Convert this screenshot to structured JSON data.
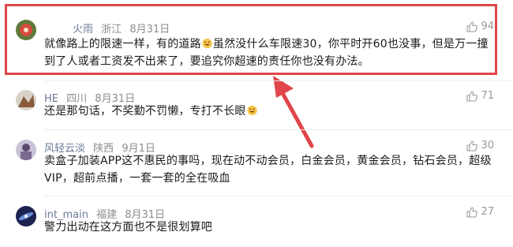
{
  "comments": [
    {
      "nickname": "火雨",
      "region": "浙江",
      "date": "8月31日",
      "likes": "94",
      "text_a": "就像路上的限速一样，有的道路",
      "text_b": "虽然没什么车限速30，你平时开60也没事，但是万一撞到了人或者工资发不出来了，要追究你超速的责任你也没有办法。"
    },
    {
      "nickname": "HE",
      "region": "四川",
      "date": "8月31日",
      "likes": "71",
      "text_a": "还是那句话，不奖勤不罚懒，专打不长眼",
      "text_b": ""
    },
    {
      "nickname": "风轻云淡",
      "region": "陕西",
      "date": "9月1日",
      "likes": "30",
      "text_a": "卖盒子加装APP这不惠民的事吗，现在动不动会员，白金会员，黄金会员，钻石会员，超级VIP，超前点播，一套一套的全在吸血",
      "text_b": ""
    },
    {
      "nickname": "int_main",
      "region": "福建",
      "date": "8月31日",
      "likes": "27",
      "text_a": "警力出动在这方面也不是很划算吧",
      "text_b": ""
    }
  ],
  "colors": {
    "highlight": "#e0464a",
    "nickname": "#6d7a99",
    "meta": "#8c8c8c"
  },
  "icons": [
    "avatar",
    "thumbs-up-icon",
    "grin-emoji-icon",
    "red-arrow-annotation"
  ]
}
